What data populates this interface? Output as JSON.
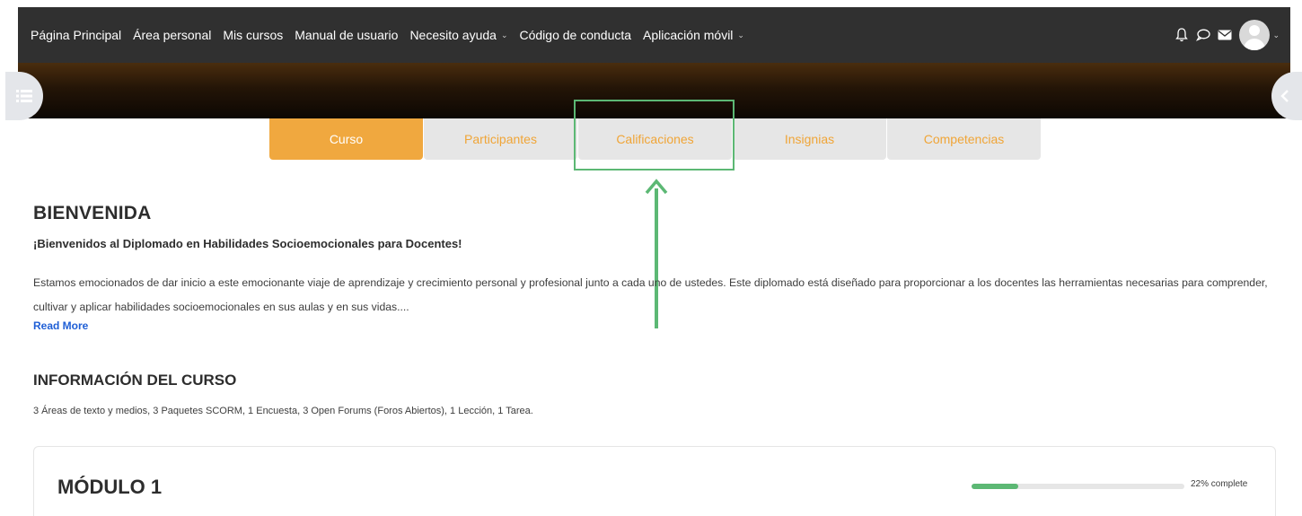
{
  "navbar": {
    "items": [
      {
        "label": "Página Principal",
        "dropdown": false
      },
      {
        "label": "Área personal",
        "dropdown": false
      },
      {
        "label": "Mis cursos",
        "dropdown": false
      },
      {
        "label": "Manual de usuario",
        "dropdown": false
      },
      {
        "label": "Necesito ayuda",
        "dropdown": true
      },
      {
        "label": "Código de conducta",
        "dropdown": false
      },
      {
        "label": "Aplicación móvil",
        "dropdown": true
      }
    ],
    "icons": [
      "bell-icon",
      "chat-icon",
      "envelope-icon",
      "user-avatar"
    ]
  },
  "tabs": [
    {
      "label": "Curso",
      "active": true
    },
    {
      "label": "Participantes",
      "active": false
    },
    {
      "label": "Calificaciones",
      "active": false
    },
    {
      "label": "Insignias",
      "active": false
    },
    {
      "label": "Competencias",
      "active": false
    }
  ],
  "welcome": {
    "heading": "BIENVENIDA",
    "subtitle": "¡Bienvenidos al Diplomado en Habilidades Socioemocionales para Docentes!",
    "paragraph": "Estamos emocionados de dar inicio a este emocionante viaje de aprendizaje y crecimiento personal y profesional junto a cada uno de ustedes. Este diplomado está diseñado para proporcionar a los docentes las herramientas necesarias para comprender, cultivar y aplicar habilidades socioemocionales en sus aulas y en sus vidas....",
    "read_more": "Read More"
  },
  "course_info": {
    "heading": "INFORMACIÓN DEL CURSO",
    "summary": "3 Áreas de texto y medios, 3 Paquetes SCORM, 1 Encuesta, 3 Open Forums (Foros Abiertos), 1 Lección, 1 Tarea."
  },
  "module": {
    "title": "MÓDULO 1",
    "progress_percent": 22,
    "progress_label": "22% complete"
  },
  "colors": {
    "navbar_bg": "#303030",
    "tab_active_bg": "#f0a83f",
    "tab_text": "#f0a537",
    "annotation_green": "#5cb874",
    "link_blue": "#1f5fd6"
  }
}
